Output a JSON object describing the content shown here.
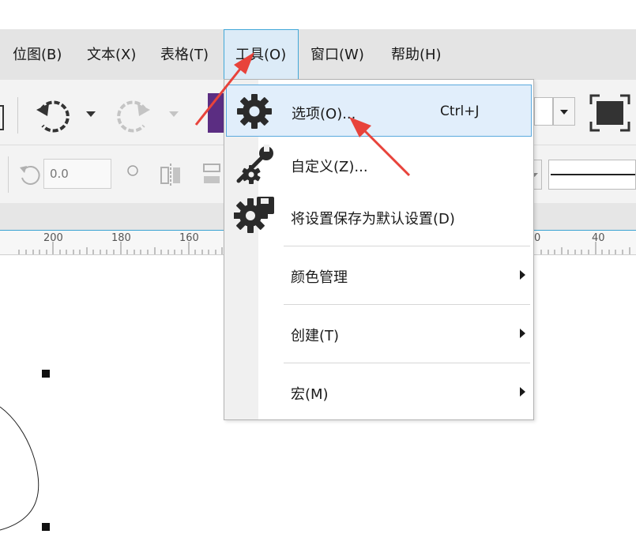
{
  "menubar": {
    "items": [
      {
        "label": "位图(B)"
      },
      {
        "label": "文本(X)"
      },
      {
        "label": "表格(T)"
      },
      {
        "label": "工具(O)"
      },
      {
        "label": "窗口(W)"
      },
      {
        "label": "帮助(H)"
      }
    ]
  },
  "toolbar": {
    "rotation_value": "0.0"
  },
  "ruler": {
    "labels": [
      "200",
      "180",
      "160",
      "0",
      "40"
    ]
  },
  "tools_menu": {
    "items": [
      {
        "label": "选项(O)...",
        "shortcut": "Ctrl+J",
        "icon": "gear-icon"
      },
      {
        "label": "自定义(Z)...",
        "icon": "customize-wrench-gear-icon"
      },
      {
        "label": "将设置保存为默认设置(D)",
        "icon": "save-settings-gear-icon"
      },
      {
        "label": "颜色管理",
        "has_submenu": true
      },
      {
        "label": "创建(T)",
        "has_submenu": true
      },
      {
        "label": "宏(M)",
        "has_submenu": true
      }
    ]
  },
  "colors": {
    "highlight_bg": "#e1eefb",
    "highlight_border": "#5aa9de",
    "annotation_arrow": "#e8433b"
  }
}
